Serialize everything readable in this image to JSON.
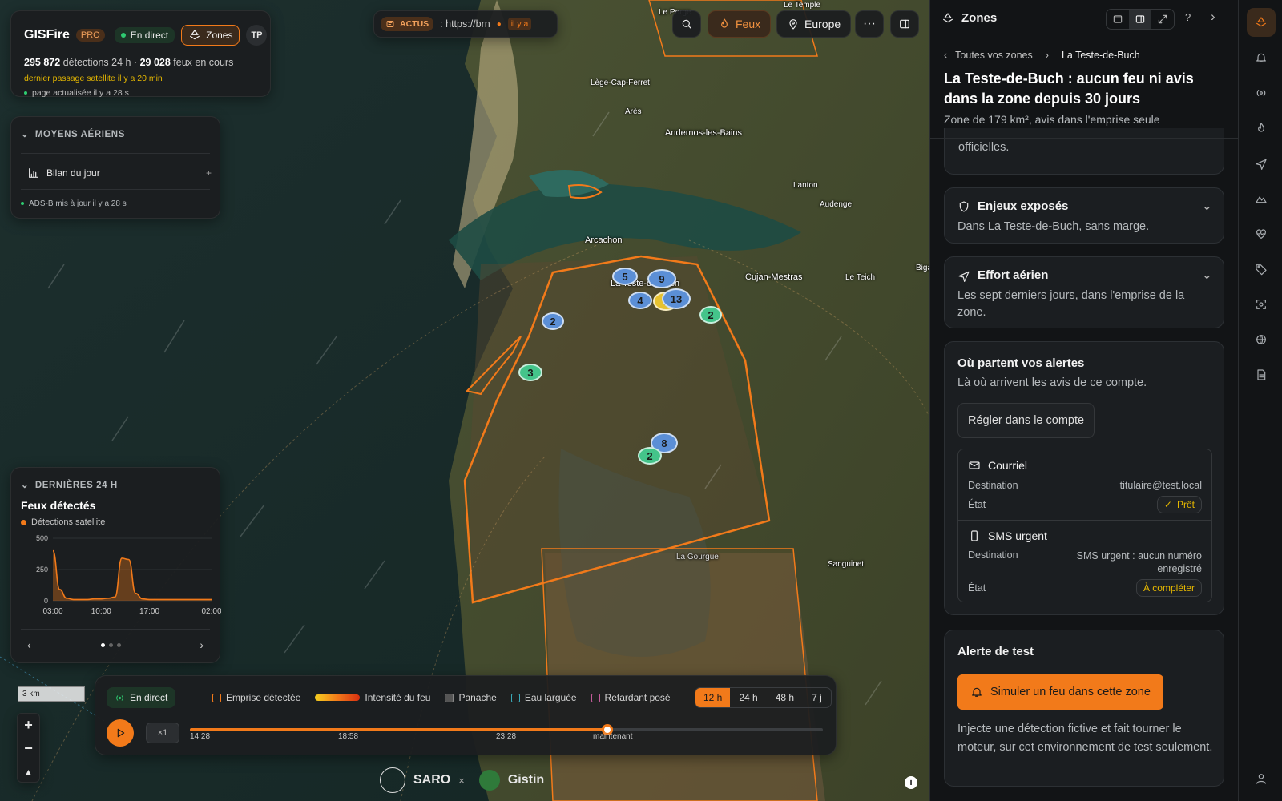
{
  "app": {
    "name": "GISFire",
    "plan": "PRO",
    "live_label": "En direct",
    "zones_label": "Zones",
    "user_initials": "TP",
    "detections_count": "295 872",
    "detections_label": "détections 24 h ·",
    "fires_count": "29 028",
    "fires_label": "feux en cours",
    "satellite_pass": "dernier passage satellite il y a 20 min",
    "page_updated": "page actualisée il y a 28 s"
  },
  "news": {
    "badge": "ACTUS",
    "text": ": https://brn",
    "tail": "il y a"
  },
  "toolbar": {
    "fires_label": "Feux",
    "region_label": "Europe"
  },
  "aerial": {
    "title": "MOYENS AÉRIENS",
    "item_label": "Bilan du jour",
    "item_action": "+",
    "adsb_status": "ADS-B mis à jour il y a 28 s"
  },
  "last24": {
    "title": "DERNIÈRES 24 H",
    "heading": "Feux détectés",
    "series_label": "Détections satellite"
  },
  "chart_data": {
    "type": "area",
    "title": "Feux détectés",
    "series": [
      {
        "name": "Détections satellite",
        "x": [
          "03:00",
          "04:00",
          "05:00",
          "06:00",
          "07:00",
          "08:00",
          "09:00",
          "10:00",
          "11:00",
          "12:00",
          "13:00",
          "14:00",
          "15:00",
          "16:00",
          "17:00",
          "18:00",
          "19:00",
          "20:00",
          "21:00",
          "22:00",
          "23:00",
          "00:00",
          "01:00",
          "02:00"
        ],
        "values": [
          400,
          90,
          20,
          10,
          10,
          10,
          15,
          15,
          20,
          30,
          340,
          330,
          60,
          15,
          10,
          10,
          10,
          10,
          10,
          10,
          10,
          10,
          10,
          10
        ]
      }
    ],
    "yticks": [
      "500",
      "250",
      "0"
    ],
    "xticks": [
      "03:00",
      "10:00",
      "17:00",
      "02:00"
    ],
    "ylim": [
      0,
      500
    ],
    "color": "#f27a1a"
  },
  "timeline": {
    "live_label": "En direct",
    "legend": [
      "Emprise détectée",
      "Intensité du feu",
      "Panache",
      "Eau larguée",
      "Retardant posé"
    ],
    "ranges": [
      "12 h",
      "24 h",
      "48 h",
      "7 j"
    ],
    "speed": "×1",
    "ticks": [
      "14:28",
      "18:58",
      "23:28",
      "maintenant"
    ],
    "progress": 0.66
  },
  "scale": {
    "label": "3 km"
  },
  "map": {
    "towns": [
      "Le Porge",
      "Le Temple",
      "Lège-Cap-Ferret",
      "Arès",
      "Andernos-les-Bains",
      "Lanton",
      "Audenge",
      "Arcachon",
      "La Teste-de-Buch",
      "Cujan-Mestras",
      "Le Teich",
      "Biga",
      "La Gourgue",
      "Sanguinet"
    ],
    "clusters": [
      "5",
      "9",
      "4",
      "7",
      "13",
      "2",
      "2",
      "3",
      "8",
      "2"
    ],
    "partners": [
      "SARO",
      "×",
      "Gistin"
    ]
  },
  "panel": {
    "title": "Zones",
    "crumb_root": "Toutes vos zones",
    "crumb_current": "La Teste-de-Buch",
    "heading": "La Teste-de-Buch : aucun feu ni avis dans la zone depuis 30 jours",
    "subheading": "Zone de 179 km², avis dans l'emprise seule",
    "partial_text": "officielles.",
    "exposed": {
      "title": "Enjeux exposés",
      "text": "Dans La Teste-de-Buch, sans marge."
    },
    "aerial_effort": {
      "title": "Effort aérien",
      "text": "Les sept derniers jours, dans l'emprise de la zone."
    },
    "alerts": {
      "title": "Où partent vos alertes",
      "text": "Là où arrivent les avis de ce compte.",
      "settings_button": "Régler dans le compte",
      "email": {
        "title": "Courriel",
        "dest_label": "Destination",
        "dest_value": "titulaire@test.local",
        "state_label": "État",
        "state_value": "Prêt"
      },
      "sms": {
        "title": "SMS urgent",
        "dest_label": "Destination",
        "dest_value": "SMS urgent : aucun numéro enregistré",
        "state_label": "État",
        "state_value": "À compléter"
      }
    },
    "test": {
      "title": "Alerte de test",
      "button": "Simuler un feu dans cette zone",
      "text": "Injecte une détection fictive et fait tourner le moteur, sur cet environnement de test seulement."
    }
  },
  "colors": {
    "accent": "#f27a1a",
    "live": "#2ecc71",
    "warning": "#e6b800"
  }
}
